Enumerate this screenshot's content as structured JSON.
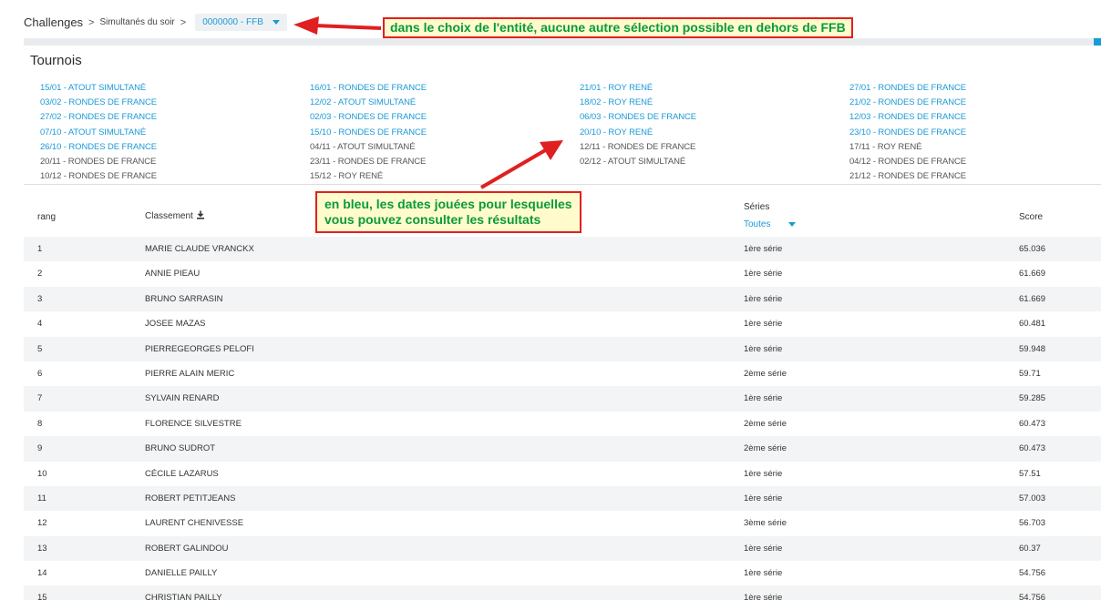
{
  "breadcrumb": {
    "root": "Challenges",
    "sep": ">",
    "section": "Simultanés du soir",
    "entity_value": "0000000 - FFB"
  },
  "tournois": {
    "title": "Tournois",
    "columns": [
      [
        {
          "label": "15/01 - ATOUT SIMULTANÉ",
          "played": true
        },
        {
          "label": "03/02 - RONDES DE FRANCE",
          "played": true
        },
        {
          "label": "27/02 - RONDES DE FRANCE",
          "played": true
        },
        {
          "label": "07/10 - ATOUT SIMULTANÉ",
          "played": true
        },
        {
          "label": "26/10 - RONDES DE FRANCE",
          "played": true
        },
        {
          "label": "20/11 - RONDES DE FRANCE",
          "played": false
        },
        {
          "label": "10/12 - RONDES DE FRANCE",
          "played": false
        }
      ],
      [
        {
          "label": "16/01 - RONDES DE FRANCE",
          "played": true
        },
        {
          "label": "12/02 - ATOUT SIMULTANÉ",
          "played": true
        },
        {
          "label": "02/03 - RONDES DE FRANCE",
          "played": true
        },
        {
          "label": "15/10 - RONDES DE FRANCE",
          "played": true
        },
        {
          "label": "04/11 - ATOUT SIMULTANÉ",
          "played": false
        },
        {
          "label": "23/11 - RONDES DE FRANCE",
          "played": false
        },
        {
          "label": "15/12 - ROY RENÉ",
          "played": false
        }
      ],
      [
        {
          "label": "21/01 - ROY RENÉ",
          "played": true
        },
        {
          "label": "18/02 - ROY RENÉ",
          "played": true
        },
        {
          "label": "06/03 - RONDES DE FRANCE",
          "played": true
        },
        {
          "label": "20/10 - ROY RENÉ",
          "played": true
        },
        {
          "label": "12/11 - RONDES DE FRANCE",
          "played": false
        },
        {
          "label": "02/12 - ATOUT SIMULTANÉ",
          "played": false
        }
      ],
      [
        {
          "label": "27/01 - RONDES DE FRANCE",
          "played": true
        },
        {
          "label": "21/02 - RONDES DE FRANCE",
          "played": true
        },
        {
          "label": "12/03 - RONDES DE FRANCE",
          "played": true
        },
        {
          "label": "23/10 - RONDES DE FRANCE",
          "played": true
        },
        {
          "label": "17/11 - ROY RENÉ",
          "played": false
        },
        {
          "label": "04/12 - RONDES DE FRANCE",
          "played": false
        },
        {
          "label": "21/12 - RONDES DE FRANCE",
          "played": false
        }
      ]
    ]
  },
  "table": {
    "headers": {
      "rank": "rang",
      "name": "Classement",
      "series": "Séries",
      "series_filter": "Toutes",
      "score": "Score"
    },
    "rows": [
      {
        "rank": "1",
        "name": "MARIE CLAUDE VRANCKX",
        "serie": "1ère série",
        "score": "65.036"
      },
      {
        "rank": "2",
        "name": "ANNIE PIEAU",
        "serie": "1ère série",
        "score": "61.669"
      },
      {
        "rank": "3",
        "name": "BRUNO SARRASIN",
        "serie": "1ère série",
        "score": "61.669"
      },
      {
        "rank": "4",
        "name": "JOSEE MAZAS",
        "serie": "1ère série",
        "score": "60.481"
      },
      {
        "rank": "5",
        "name": "PIERREGEORGES PELOFI",
        "serie": "1ère série",
        "score": "59.948"
      },
      {
        "rank": "6",
        "name": "PIERRE ALAIN MERIC",
        "serie": "2ème série",
        "score": "59.71"
      },
      {
        "rank": "7",
        "name": "SYLVAIN RENARD",
        "serie": "1ère série",
        "score": "59.285"
      },
      {
        "rank": "8",
        "name": "FLORENCE SILVESTRE",
        "serie": "2ème série",
        "score": "60.473"
      },
      {
        "rank": "9",
        "name": "BRUNO SUDROT",
        "serie": "2ème série",
        "score": "60.473"
      },
      {
        "rank": "10",
        "name": "CÉCILE LAZARUS",
        "serie": "1ère série",
        "score": "57.51"
      },
      {
        "rank": "11",
        "name": "ROBERT PETITJEANS",
        "serie": "1ère série",
        "score": "57.003"
      },
      {
        "rank": "12",
        "name": "LAURENT CHENIVESSE",
        "serie": "3ème série",
        "score": "56.703"
      },
      {
        "rank": "13",
        "name": "ROBERT GALINDOU",
        "serie": "1ère série",
        "score": "60.37"
      },
      {
        "rank": "14",
        "name": "DANIELLE PAILLY",
        "serie": "1ère série",
        "score": "54.756"
      },
      {
        "rank": "15",
        "name": "CHRISTIAN PAILLY",
        "serie": "1ère série",
        "score": "54.756"
      }
    ]
  },
  "annotations": {
    "entity_note": "dans le choix de l'entité, aucune autre sélection possible en dehors de FFB",
    "dates_note_line1": "en bleu, les dates jouées pour lesquelles",
    "dates_note_line2": "vous pouvez consulter les résultats"
  },
  "colors": {
    "accent": "#1a9ad6",
    "annotation_border": "#e02020",
    "annotation_text": "#0a9a3a",
    "annotation_bg": "#fffbcc"
  },
  "icons": {
    "download": "download-icon",
    "caret": "chevron-down-icon",
    "arrow": "red-arrow-icon"
  }
}
